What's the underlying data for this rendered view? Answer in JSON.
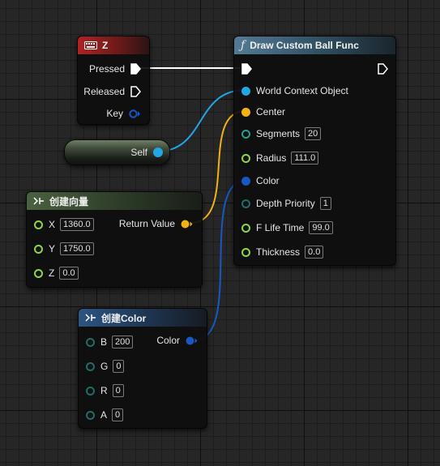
{
  "event_node": {
    "title": "Z",
    "icon": "keyboard-icon",
    "accent": "#b02222",
    "pins": {
      "pressed": "Pressed",
      "released": "Released",
      "key": "Key"
    }
  },
  "self_node": {
    "label": "Self"
  },
  "func_node": {
    "title": "Draw Custom Ball Func",
    "icon": "function-icon",
    "accent": "#537b95",
    "pins": {
      "world_context": "World Context Object",
      "center": "Center",
      "segments": "Segments",
      "radius": "Radius",
      "color": "Color",
      "depth_priority": "Depth Priority",
      "life_time": "F Life Time",
      "thickness": "Thickness"
    },
    "values": {
      "segments": "20",
      "radius": "111.0",
      "depth_priority": "1",
      "life_time": "99.0",
      "thickness": "0.0"
    }
  },
  "make_vector": {
    "title": "创建向量",
    "icon": "make-struct-icon",
    "output": "Return Value",
    "inputs": [
      {
        "label": "X",
        "value": "1360.0"
      },
      {
        "label": "Y",
        "value": "1750.0"
      },
      {
        "label": "Z",
        "value": "0.0"
      }
    ]
  },
  "make_color": {
    "title": "创建Color",
    "icon": "make-struct-icon",
    "output": "Color",
    "inputs": [
      {
        "label": "B",
        "value": "200"
      },
      {
        "label": "G",
        "value": "0"
      },
      {
        "label": "R",
        "value": "0"
      },
      {
        "label": "A",
        "value": "0"
      }
    ]
  },
  "colors": {
    "exec": "#ffffff",
    "object": "#22a6e6",
    "vector": "#f2b115",
    "color_struct": "#1857c4",
    "float": "#8cd646",
    "int": "#23a08c",
    "byte": "#1d6e66"
  }
}
